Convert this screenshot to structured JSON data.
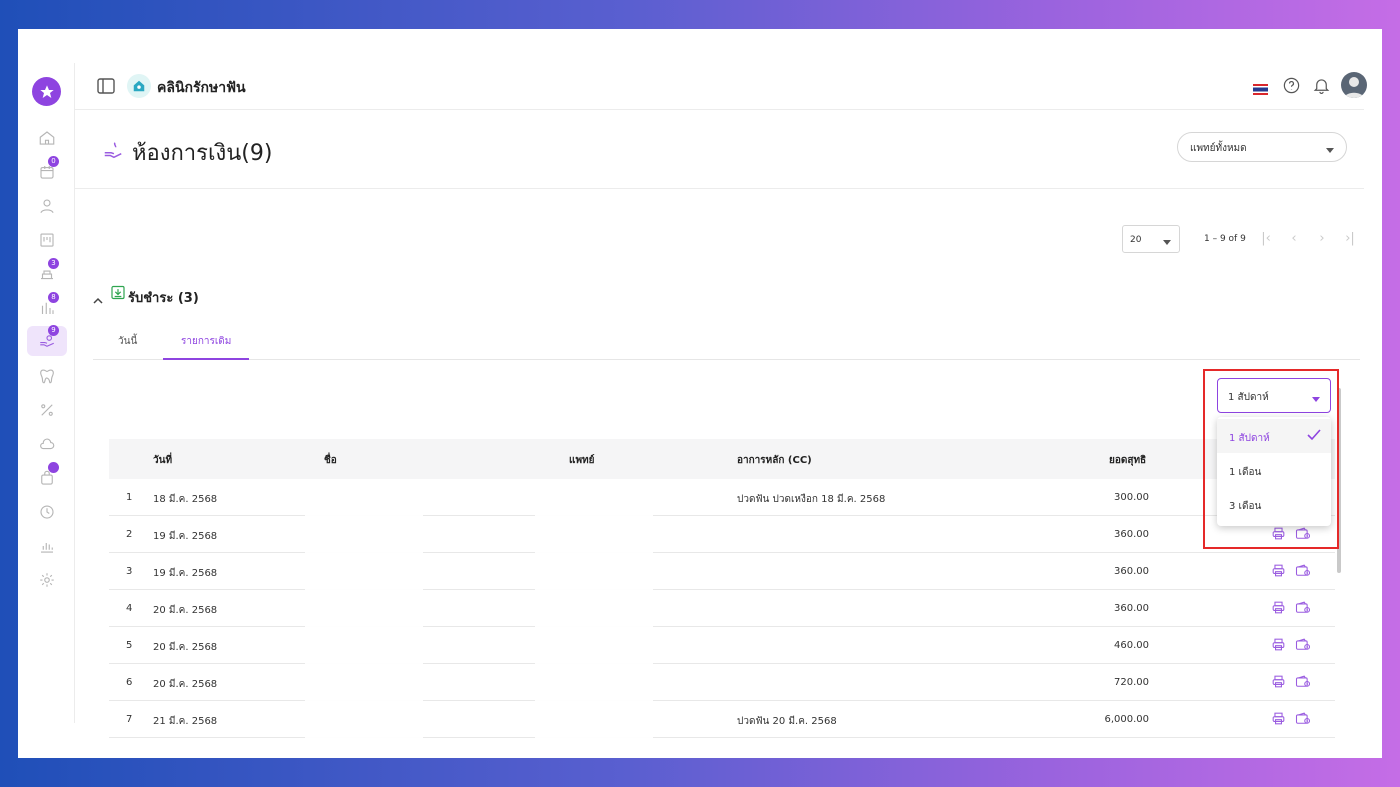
{
  "header": {
    "clinic_name": "คลินิกรักษาฟัน"
  },
  "sidebar": {
    "items": [
      {
        "icon": "home-icon",
        "badge": ""
      },
      {
        "icon": "calendar-icon",
        "badge": "0"
      },
      {
        "icon": "user-icon",
        "badge": ""
      },
      {
        "icon": "board-icon",
        "badge": ""
      },
      {
        "icon": "dental-chair-icon",
        "badge": "3"
      },
      {
        "icon": "tools-icon",
        "badge": "8"
      },
      {
        "icon": "payment-hand-icon",
        "badge": "9"
      },
      {
        "icon": "tooth-icon",
        "badge": ""
      },
      {
        "icon": "percent-icon",
        "badge": ""
      },
      {
        "icon": "cloud-icon",
        "badge": ""
      },
      {
        "icon": "bag-icon",
        "badge": "•"
      },
      {
        "icon": "clock-icon",
        "badge": ""
      },
      {
        "icon": "chart-icon",
        "badge": ""
      },
      {
        "icon": "gear-icon",
        "badge": ""
      }
    ]
  },
  "page": {
    "title": "ห้องการเงิน(9)",
    "doctor_filter": "แพทย์ทั้งหมด"
  },
  "pager": {
    "size": "20",
    "range": "1 – 9 of 9"
  },
  "section": {
    "title": "รับชำระ (3)",
    "tabs": [
      "วันนี้",
      "รายการเดิม"
    ]
  },
  "range_filter": {
    "selected": "1 สัปดาห์",
    "options": [
      "1 สัปดาห์",
      "1 เดือน",
      "3 เดือน"
    ]
  },
  "table": {
    "columns": [
      "วันที่",
      "ชื่อ",
      "แพทย์",
      "อาการหลัก (CC)",
      "ยอดสุทธิ"
    ],
    "rows": [
      {
        "no": "1",
        "date": "18 มี.ค. 2568",
        "cc": "ปวดฟัน ปวดเหงือก 18 มี.ค. 2568",
        "amount": "300.00"
      },
      {
        "no": "2",
        "date": "19 มี.ค. 2568",
        "cc": "",
        "amount": "360.00"
      },
      {
        "no": "3",
        "date": "19 มี.ค. 2568",
        "cc": "",
        "amount": "360.00"
      },
      {
        "no": "4",
        "date": "20 มี.ค. 2568",
        "cc": "",
        "amount": "360.00"
      },
      {
        "no": "5",
        "date": "20 มี.ค. 2568",
        "cc": "",
        "amount": "460.00"
      },
      {
        "no": "6",
        "date": "20 มี.ค. 2568",
        "cc": "",
        "amount": "720.00"
      },
      {
        "no": "7",
        "date": "21 มี.ค. 2568",
        "cc": "ปวดฟัน 20 มี.ค. 2568",
        "amount": "6,000.00"
      }
    ]
  },
  "colors": {
    "accent": "#8e44e0",
    "highlight": "#e52929"
  }
}
